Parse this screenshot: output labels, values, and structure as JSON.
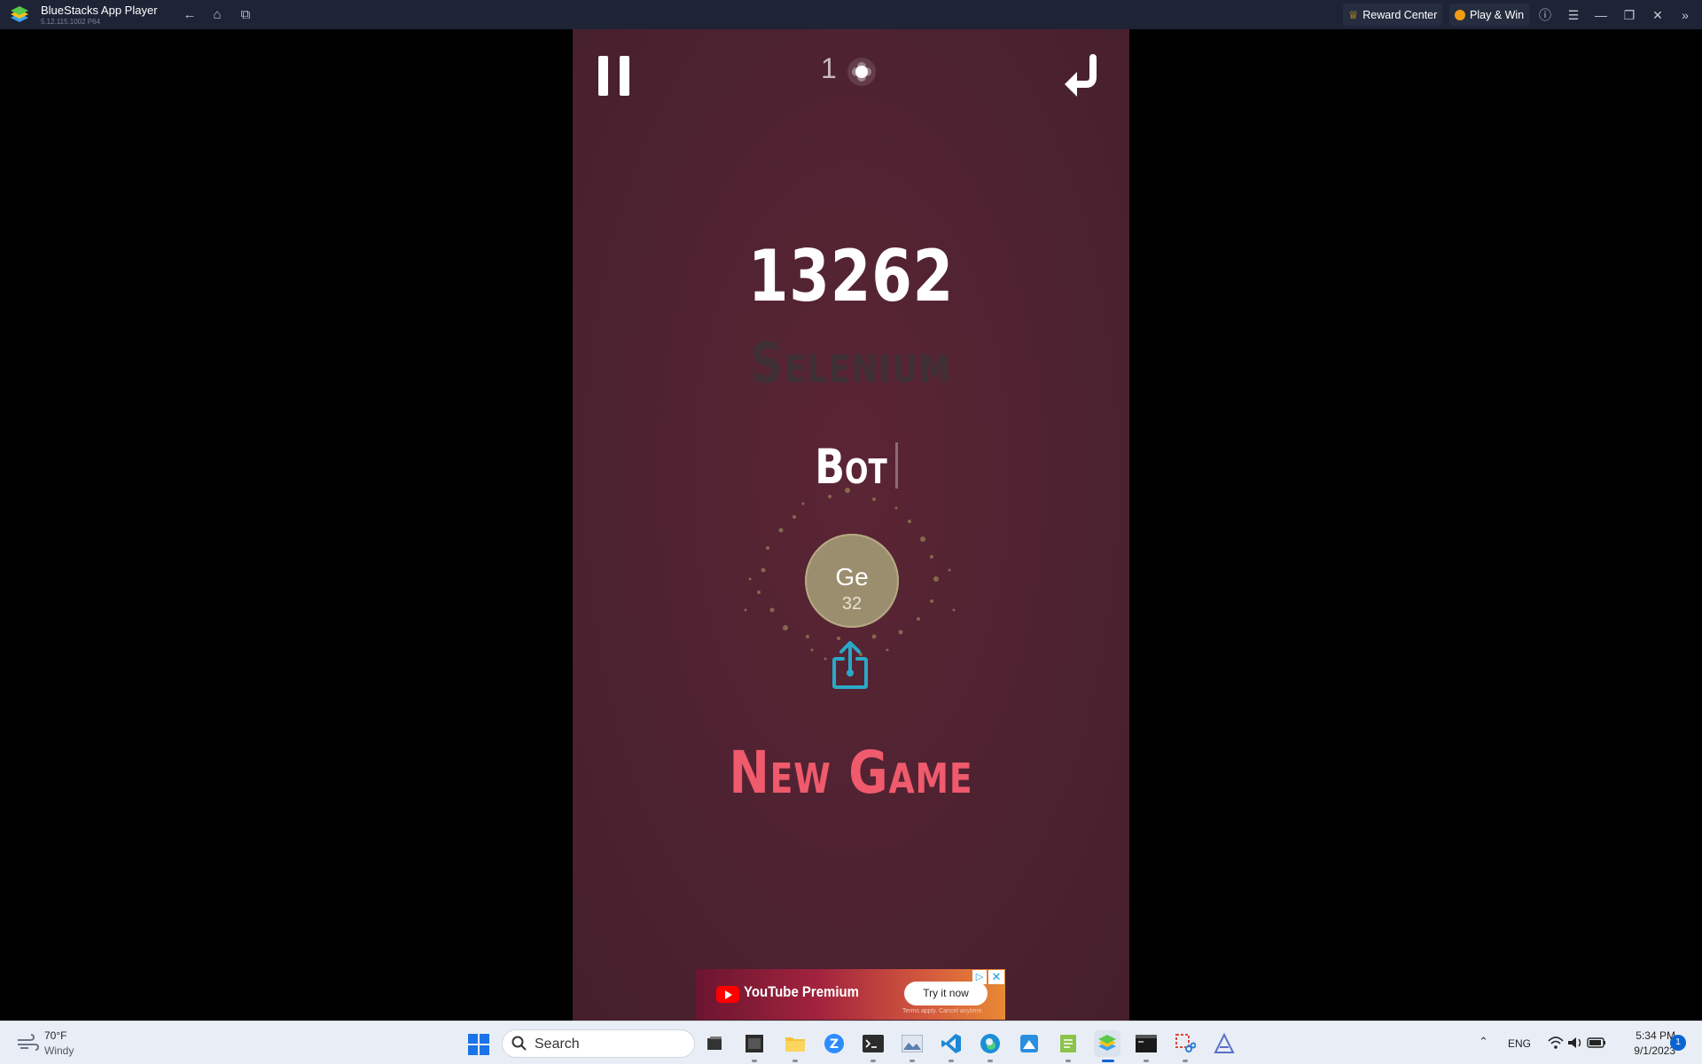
{
  "window": {
    "title": "BlueStacks App Player",
    "version": "5.12.115.1002 P64",
    "reward_center": "Reward Center",
    "play_win": "Play & Win"
  },
  "game": {
    "level": "1",
    "score": "13262",
    "element_name": "Selenium",
    "player_name": "Bot",
    "atom_symbol": "Ge",
    "atom_number": "32",
    "new_game": "New Game",
    "colors": {
      "background": "#4e2231",
      "accent": "#ef5a6c",
      "atom": "#9b8e6e",
      "share": "#2aa9c8"
    }
  },
  "ad": {
    "brand": "YouTube Premium",
    "cta": "Try it now",
    "terms": "Terms apply. Cancel anytime.",
    "choice_icon": "ad-choices-icon",
    "close_icon": "close-icon"
  },
  "taskbar": {
    "weather_temp": "70°F",
    "weather_desc": "Windy",
    "search_label": "Search",
    "apps": [
      "task-view",
      "app-2",
      "file-explorer",
      "zoom",
      "terminal",
      "photos",
      "vscode",
      "edge",
      "paint",
      "notepad",
      "bluestacks",
      "cmd",
      "snipping-tool",
      "app-14"
    ],
    "active_app": "bluestacks",
    "lang": "ENG",
    "time": "5:34 PM",
    "date": "9/1/2023",
    "notifications": "1"
  }
}
